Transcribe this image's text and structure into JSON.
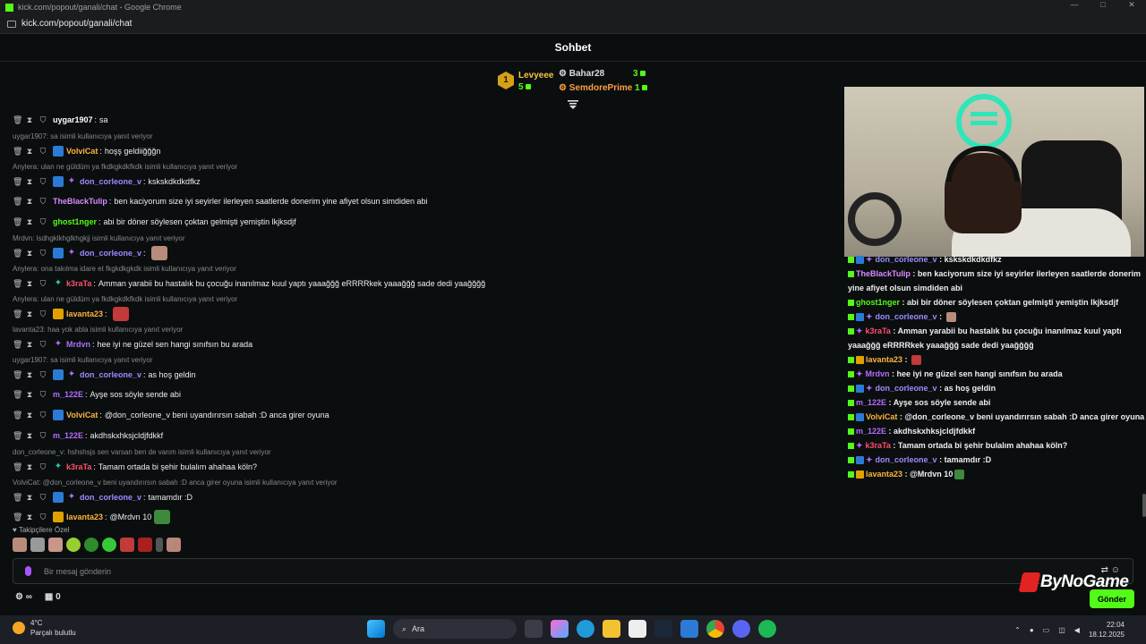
{
  "browser": {
    "title": "kick.com/popout/ganali/chat - Google Chrome",
    "url": "kick.com/popout/ganali/chat"
  },
  "chat_header": {
    "title": "Sohbet"
  },
  "leaderboard": {
    "rank": "1",
    "first": {
      "name": "Levyeee",
      "count": "5"
    },
    "second": {
      "name": "Bahar28",
      "count": "3"
    },
    "third": {
      "name": "SemdorePrime",
      "count": "1"
    }
  },
  "messages": [
    {
      "reply": "",
      "badges": [],
      "user": "uygar1907",
      "color": "#ffffff",
      "text": "sa"
    },
    {
      "reply": "uygar1907: sa isimli kullanıcıya yanıt veriyor",
      "badges": [
        "blue"
      ],
      "user": "VolviCat",
      "color": "#ffb23b",
      "text": "hoşş geldiiğğğn"
    },
    {
      "reply": "Anylera: ulan ne güldüm ya fkdkgkdkfkdk isimli kullanıcıya yanıt veriyor",
      "badges": [
        "blue",
        "purple"
      ],
      "user": "don_corleone_v",
      "color": "#9b8cff",
      "text": "kskskdkdkdfkz"
    },
    {
      "reply": "",
      "badges": [],
      "user": "TheBlackTulip",
      "color": "#d88bff",
      "text": "ben kaciyorum size iyi seyirler ilerleyen saatlerde donerim yine afiyet olsun simdiden abi"
    },
    {
      "reply": "",
      "badges": [],
      "user": "ghost1nger",
      "color": "#53fc18",
      "text": "abi bir döner söylesen çoktan gelmişti yemiştin lkjksdjf"
    },
    {
      "reply": "Mrdvn: lsdhgklkhglkhgkjj isimli kullanıcıya yanıt veriyor",
      "badges": [
        "blue",
        "purple"
      ],
      "user": "don_corleone_v",
      "color": "#9b8cff",
      "text": "",
      "emote": "face"
    },
    {
      "reply": "Anylera: ona takılma idare et fkgkdkgkdk isimli kullanıcıya yanıt veriyor",
      "badges": [
        "teal"
      ],
      "user": "k3raTa",
      "color": "#ff4f6d",
      "text": "Amman yarabii bu hastalık bu çocuğu inanılmaz kuul yaptı yaaağğğ eRRRRkek yaaağğğ sade dedi yaağğğğ"
    },
    {
      "reply": "Anylera: ulan ne güldüm ya fkdkgkdkfkdk isimli kullanıcıya yanıt veriyor",
      "badges": [
        "gold"
      ],
      "user": "lavanta23",
      "color": "#ffb23b",
      "text": "",
      "emote": "red"
    },
    {
      "reply": "lavanta23: haa yok abla isimli kullanıcıya yanıt veriyor",
      "badges": [
        "purple"
      ],
      "user": "Mrdvn",
      "color": "#b36bff",
      "text": "hee iyi ne güzel sen hangi sınıfsın bu arada"
    },
    {
      "reply": "uygar1907: sa isimli kullanıcıya yanıt veriyor",
      "badges": [
        "blue",
        "purple"
      ],
      "user": "don_corleone_v",
      "color": "#9b8cff",
      "text": "as hoş geldin"
    },
    {
      "reply": "",
      "badges": [],
      "user": "m_122E",
      "color": "#b36bff",
      "text": "Ayşe sos söyle sende abi"
    },
    {
      "reply": "",
      "badges": [
        "blue"
      ],
      "user": "VolviCat",
      "color": "#ffb23b",
      "text": "@don_corleone_v beni uyandırırsın sabah :D anca girer oyuna"
    },
    {
      "reply": "",
      "badges": [],
      "user": "m_122E",
      "color": "#b36bff",
      "text": "akdhskxhksjcldjfdkkf"
    },
    {
      "reply": "don_corleone_v: hshshsjs sen varsan ben de varım isimli kullanıcıya yanıt veriyor",
      "badges": [
        "teal"
      ],
      "user": "k3raTa",
      "color": "#ff4f6d",
      "text": "Tamam ortada bi şehir bulalım ahahaa köln?"
    },
    {
      "reply": "VolviCat: @don_corleone_v beni uyandırırsın sabah :D anca girer oyuna isimli kullanıcıya yanıt veriyor",
      "badges": [
        "blue",
        "purple"
      ],
      "user": "don_corleone_v",
      "color": "#9b8cff",
      "text": "tamamdır :D"
    },
    {
      "reply": "",
      "badges": [
        "gold"
      ],
      "user": "lavanta23",
      "color": "#ffb23b",
      "text": "@Mrdvn 10",
      "emote": "green"
    }
  ],
  "follower_label": "Takipçilere Özel",
  "input": {
    "placeholder": "Bir mesaj gönderin"
  },
  "send_label": "Gönder",
  "bottom": {
    "points": "0"
  },
  "watermark": "ByNoGame",
  "side_chat": [
    {
      "user": "don_corleone_v",
      "color": "#9b8cff",
      "text": "kskskdkdkdfkz",
      "b": [
        "bb",
        "bp"
      ]
    },
    {
      "user": "TheBlackTulip",
      "color": "#d88bff",
      "text": "ben kaciyorum size iyi seyirler ilerleyen saatlerde donerim yine afiyet olsun simdiden abi",
      "b": []
    },
    {
      "user": "ghost1nger",
      "color": "#53fc18",
      "text": "abi bir döner söylesen çoktan gelmişti yemiştin lkjksdjf",
      "b": []
    },
    {
      "user": "don_corleone_v",
      "color": "#9b8cff",
      "text": "",
      "b": [
        "bb",
        "bp"
      ],
      "em": "#b88c7a"
    },
    {
      "user": "k3raTa",
      "color": "#ff4f6d",
      "text": "Amman yarabii bu hastalık bu çocuğu inanılmaz kuul yaptı yaaağğğ eRRRRkek yaaağğğ sade dedi yaağğğğ",
      "b": [
        "bp"
      ]
    },
    {
      "user": "lavanta23",
      "color": "#ffb23b",
      "text": "",
      "b": [
        "bg"
      ],
      "em": "#c23a3a"
    },
    {
      "user": "Mrdvn",
      "color": "#b36bff",
      "text": "hee iyi ne güzel sen hangi sınıfsın bu arada",
      "b": [
        "bp"
      ]
    },
    {
      "user": "don_corleone_v",
      "color": "#9b8cff",
      "text": "as hoş geldin",
      "b": [
        "bb",
        "bp"
      ]
    },
    {
      "user": "m_122E",
      "color": "#b36bff",
      "text": "Ayşe sos söyle sende abi",
      "b": []
    },
    {
      "user": "VolviCat",
      "color": "#ffb23b",
      "text": "@don_corleone_v beni uyandırırsın sabah :D anca girer oyuna",
      "b": [
        "bb"
      ]
    },
    {
      "user": "m_122E",
      "color": "#b36bff",
      "text": "akdhskxhksjcldjfdkkf",
      "b": []
    },
    {
      "user": "k3raTa",
      "color": "#ff4f6d",
      "text": "Tamam ortada bi şehir bulalım ahahaa köln?",
      "b": [
        "bp"
      ]
    },
    {
      "user": "don_corleone_v",
      "color": "#9b8cff",
      "text": "tamamdır :D",
      "b": [
        "bb",
        "bp"
      ]
    },
    {
      "user": "lavanta23",
      "color": "#ffb23b",
      "text": "@Mrdvn 10",
      "b": [
        "bg"
      ],
      "em": "#3d8a3d"
    }
  ],
  "taskbar": {
    "temp": "4°C",
    "weather": "Parçalı bulutlu",
    "search": "Ara",
    "time": "22:04",
    "date": "18.12.2025"
  }
}
